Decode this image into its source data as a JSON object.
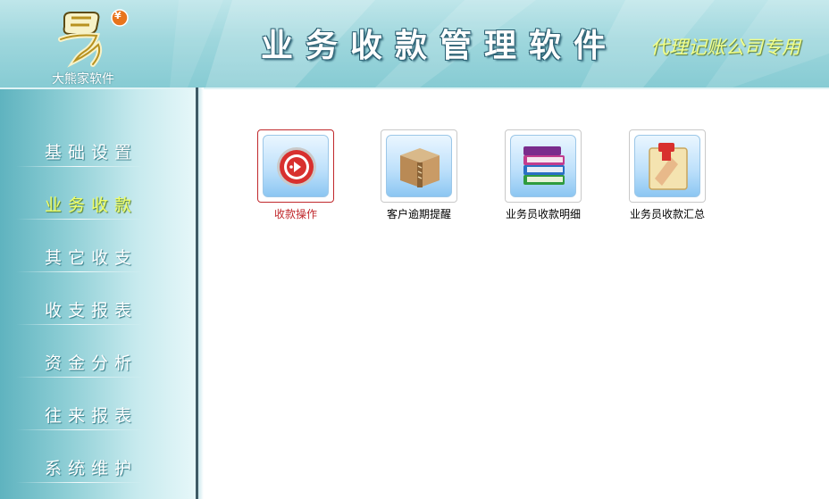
{
  "header": {
    "brand_name": "大熊家软件",
    "app_title": "业务收款管理软件",
    "app_subtitle": "代理记账公司专用",
    "logo_badge": "¥"
  },
  "sidebar": {
    "items": [
      {
        "label": "基础设置",
        "active": false
      },
      {
        "label": "业务收款",
        "active": true
      },
      {
        "label": "其它收支",
        "active": false
      },
      {
        "label": "收支报表",
        "active": false
      },
      {
        "label": "资金分析",
        "active": false
      },
      {
        "label": "往来报表",
        "active": false
      },
      {
        "label": "系统维护",
        "active": false
      }
    ]
  },
  "main": {
    "tiles": [
      {
        "label": "收款操作",
        "icon": "play-circle-icon",
        "selected": true
      },
      {
        "label": "客户逾期提醒",
        "icon": "package-box-icon",
        "selected": false
      },
      {
        "label": "业务员收款明细",
        "icon": "books-stack-icon",
        "selected": false
      },
      {
        "label": "业务员收款汇总",
        "icon": "stamp-icon",
        "selected": false
      }
    ]
  },
  "colors": {
    "active_nav": "#f0ff6a",
    "selected_tile_border": "#c0282c",
    "header_bg": "#9fd7dd",
    "sidebar_edge": "#3e5a66"
  }
}
